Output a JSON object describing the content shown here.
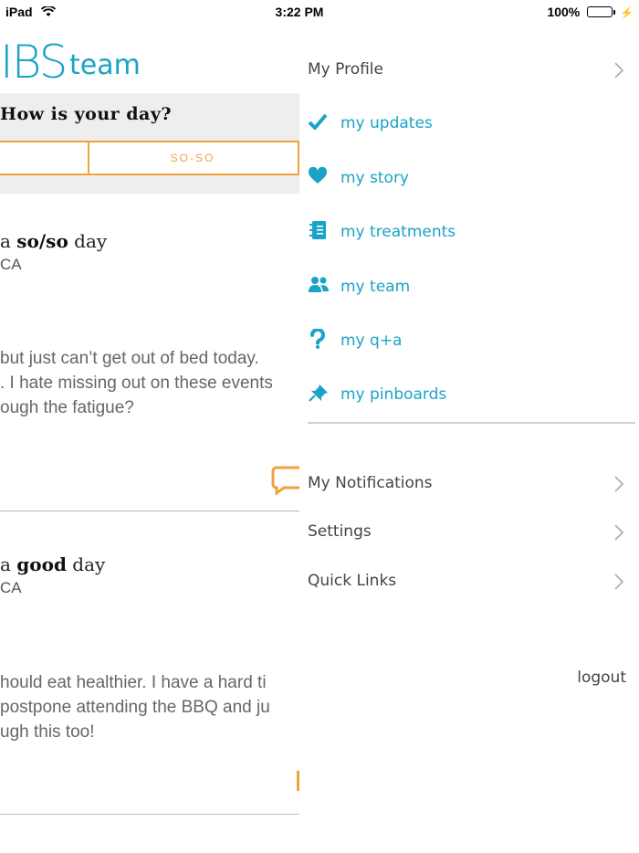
{
  "status_bar": {
    "device": "iPad",
    "time": "3:22 PM",
    "battery": "100%"
  },
  "app": {
    "logo_ibs": "IBS",
    "logo_team": "team",
    "day_question": "How is your day?",
    "mood_option": "SO-SO"
  },
  "feed": [
    {
      "title_prefix": "a ",
      "title_mood": "so/so",
      "title_suffix": " day",
      "location": "CA",
      "body": [
        "but just can’t get out of bed today.",
        ". I hate missing out on these events",
        "ough the fatigue?"
      ]
    },
    {
      "title_prefix": "a ",
      "title_mood": "good",
      "title_suffix": " day",
      "location": "CA",
      "body": [
        "hould eat healthier. I have a hard ti",
        "postpone attending the BBQ and ju",
        "ugh this too!"
      ]
    }
  ],
  "drawer": {
    "profile_label": "My Profile",
    "menu": [
      {
        "label": "my updates",
        "icon": "check-icon"
      },
      {
        "label": "my story",
        "icon": "heart-icon"
      },
      {
        "label": "my treatments",
        "icon": "notebook-icon"
      },
      {
        "label": "my team",
        "icon": "people-icon"
      },
      {
        "label": "my q+a",
        "icon": "question-icon"
      },
      {
        "label": "my pinboards",
        "icon": "pin-icon"
      }
    ],
    "notifications_label": "My Notifications",
    "settings_label": "Settings",
    "quick_links_label": "Quick Links",
    "logout_label": "logout"
  },
  "colors": {
    "accent": "#1aa3c7",
    "mood_orange": "#f0a23b"
  }
}
